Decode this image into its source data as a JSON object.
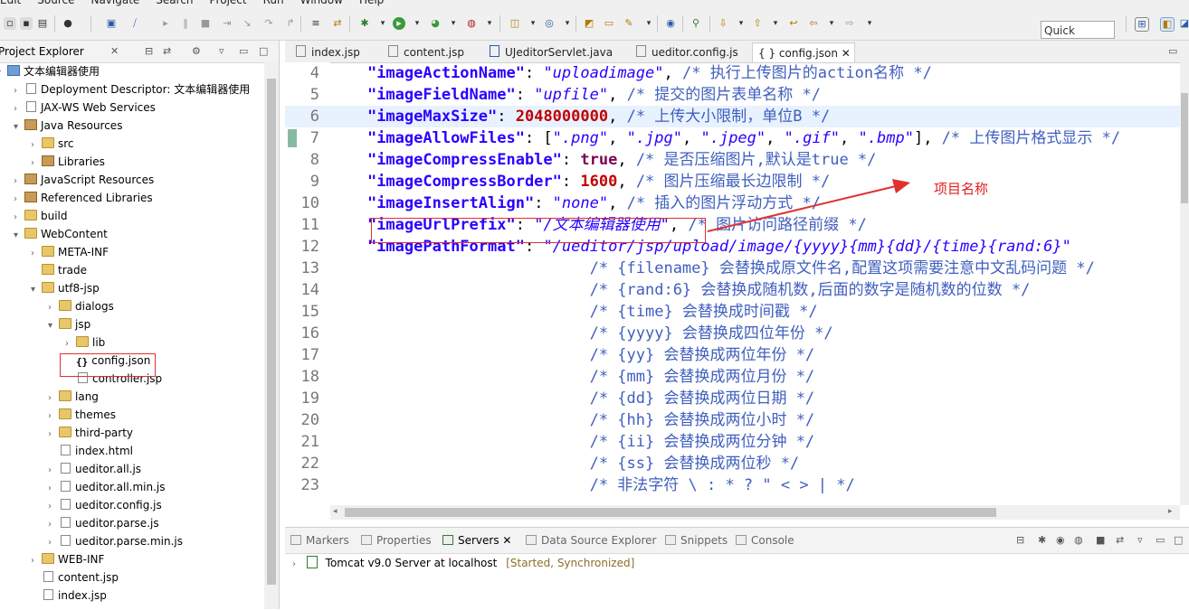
{
  "menu": [
    "Edit",
    "Source",
    "Navigate",
    "Search",
    "Project",
    "Run",
    "Window",
    "Help"
  ],
  "toolbar": {
    "quick_access": "Quick Access"
  },
  "explorer": {
    "title": "Project Explorer",
    "close": "✕",
    "tree": [
      {
        "label": "文本编辑器使用",
        "indent": 0,
        "arrow": "▾",
        "icon": "proj"
      },
      {
        "label": "Deployment Descriptor: 文本编辑器使用",
        "indent": 1,
        "arrow": "›",
        "icon": "file"
      },
      {
        "label": "JAX-WS Web Services",
        "indent": 1,
        "arrow": "›",
        "icon": "file"
      },
      {
        "label": "Java Resources",
        "indent": 1,
        "arrow": "▾",
        "icon": "lib"
      },
      {
        "label": "src",
        "indent": 2,
        "arrow": "›",
        "icon": "folder"
      },
      {
        "label": "Libraries",
        "indent": 2,
        "arrow": "›",
        "icon": "lib"
      },
      {
        "label": "JavaScript Resources",
        "indent": 1,
        "arrow": "›",
        "icon": "lib"
      },
      {
        "label": "Referenced Libraries",
        "indent": 1,
        "arrow": "›",
        "icon": "lib"
      },
      {
        "label": "build",
        "indent": 1,
        "arrow": "›",
        "icon": "folder"
      },
      {
        "label": "WebContent",
        "indent": 1,
        "arrow": "▾",
        "icon": "folder"
      },
      {
        "label": "META-INF",
        "indent": 2,
        "arrow": "›",
        "icon": "folder"
      },
      {
        "label": "trade",
        "indent": 2,
        "arrow": "",
        "icon": "folder"
      },
      {
        "label": "utf8-jsp",
        "indent": 2,
        "arrow": "▾",
        "icon": "folder"
      },
      {
        "label": "dialogs",
        "indent": 3,
        "arrow": "›",
        "icon": "folder"
      },
      {
        "label": "jsp",
        "indent": 3,
        "arrow": "▾",
        "icon": "folder"
      },
      {
        "label": "lib",
        "indent": 4,
        "arrow": "›",
        "icon": "folder"
      },
      {
        "label": "config.json",
        "indent": 4,
        "arrow": "",
        "icon": "json"
      },
      {
        "label": "controller.jsp",
        "indent": 4,
        "arrow": "",
        "icon": "file"
      },
      {
        "label": "lang",
        "indent": 3,
        "arrow": "›",
        "icon": "folder"
      },
      {
        "label": "themes",
        "indent": 3,
        "arrow": "›",
        "icon": "folder"
      },
      {
        "label": "third-party",
        "indent": 3,
        "arrow": "›",
        "icon": "folder"
      },
      {
        "label": "index.html",
        "indent": 3,
        "arrow": "",
        "icon": "file"
      },
      {
        "label": "ueditor.all.js",
        "indent": 3,
        "arrow": "›",
        "icon": "file"
      },
      {
        "label": "ueditor.all.min.js",
        "indent": 3,
        "arrow": "›",
        "icon": "file"
      },
      {
        "label": "ueditor.config.js",
        "indent": 3,
        "arrow": "›",
        "icon": "file"
      },
      {
        "label": "ueditor.parse.js",
        "indent": 3,
        "arrow": "›",
        "icon": "file"
      },
      {
        "label": "ueditor.parse.min.js",
        "indent": 3,
        "arrow": "›",
        "icon": "file"
      },
      {
        "label": "WEB-INF",
        "indent": 2,
        "arrow": "›",
        "icon": "folder"
      },
      {
        "label": "content.jsp",
        "indent": 2,
        "arrow": "",
        "icon": "file"
      },
      {
        "label": "index.jsp",
        "indent": 2,
        "arrow": "",
        "icon": "file"
      }
    ]
  },
  "editor": {
    "tabs": [
      {
        "label": "index.jsp"
      },
      {
        "label": "content.jsp"
      },
      {
        "label": "UJeditorServlet.java"
      },
      {
        "label": "ueditor.config.js"
      },
      {
        "label": "{ } config.json  ✕"
      }
    ],
    "lines": [
      {
        "n": "4",
        "parts": [
          [
            "p",
            "    "
          ],
          [
            "k",
            "\"imageActionName\""
          ],
          [
            "p",
            ": "
          ],
          [
            "s",
            "\"uploadimage\""
          ],
          [
            "p",
            ", "
          ],
          [
            "c",
            "/* 执行上传图片的action名称 */"
          ]
        ]
      },
      {
        "n": "5",
        "parts": [
          [
            "p",
            "    "
          ],
          [
            "k",
            "\"imageFieldName\""
          ],
          [
            "p",
            ": "
          ],
          [
            "s",
            "\"upfile\""
          ],
          [
            "p",
            ", "
          ],
          [
            "c",
            "/* 提交的图片表单名称 */"
          ]
        ]
      },
      {
        "n": "6",
        "parts": [
          [
            "p",
            "    "
          ],
          [
            "k",
            "\"imageMaxSize\""
          ],
          [
            "p",
            ": "
          ],
          [
            "n",
            "2048000000"
          ],
          [
            "p",
            ", "
          ],
          [
            "c",
            "/* 上传大小限制，单位B */"
          ]
        ]
      },
      {
        "n": "7",
        "parts": [
          [
            "p",
            "    "
          ],
          [
            "k",
            "\"imageAllowFiles\""
          ],
          [
            "p",
            ": ["
          ],
          [
            "s",
            "\".png\""
          ],
          [
            "p",
            ", "
          ],
          [
            "s",
            "\".jpg\""
          ],
          [
            "p",
            ", "
          ],
          [
            "s",
            "\".jpeg\""
          ],
          [
            "p",
            ", "
          ],
          [
            "s",
            "\".gif\""
          ],
          [
            "p",
            ", "
          ],
          [
            "s",
            "\".bmp\""
          ],
          [
            "p",
            "], "
          ],
          [
            "c",
            "/* 上传图片格式显示 */"
          ]
        ]
      },
      {
        "n": "8",
        "parts": [
          [
            "p",
            "    "
          ],
          [
            "k",
            "\"imageCompressEnable\""
          ],
          [
            "p",
            ": "
          ],
          [
            "b",
            "true"
          ],
          [
            "p",
            ", "
          ],
          [
            "c",
            "/* 是否压缩图片,默认是true */"
          ]
        ]
      },
      {
        "n": "9",
        "parts": [
          [
            "p",
            "    "
          ],
          [
            "k",
            "\"imageCompressBorder\""
          ],
          [
            "p",
            ": "
          ],
          [
            "n",
            "1600"
          ],
          [
            "p",
            ", "
          ],
          [
            "c",
            "/* 图片压缩最长边限制 */"
          ]
        ]
      },
      {
        "n": "10",
        "parts": [
          [
            "p",
            "    "
          ],
          [
            "k",
            "\"imageInsertAlign\""
          ],
          [
            "p",
            ": "
          ],
          [
            "s",
            "\"none\""
          ],
          [
            "p",
            ", "
          ],
          [
            "c",
            "/* 插入的图片浮动方式 */"
          ]
        ]
      },
      {
        "n": "11",
        "parts": [
          [
            "p",
            "    "
          ],
          [
            "k",
            "\"imageUrlPrefix\""
          ],
          [
            "p",
            ": "
          ],
          [
            "s",
            "\"/文本编辑器使用\""
          ],
          [
            "p",
            ", "
          ],
          [
            "c",
            "/* 图片访问路径前缀 */"
          ]
        ]
      },
      {
        "n": "12",
        "parts": [
          [
            "p",
            "    "
          ],
          [
            "k",
            "\"imagePathFormat\""
          ],
          [
            "p",
            ": "
          ],
          [
            "s",
            "\"/ueditor/jsp/upload/image/{yyyy}{mm}{dd}/{time}{rand:6}\""
          ]
        ]
      },
      {
        "n": "13",
        "parts": [
          [
            "p",
            "                            "
          ],
          [
            "c",
            "/* {filename} 会替换成原文件名,配置这项需要注意中文乱码问题 */"
          ]
        ]
      },
      {
        "n": "14",
        "parts": [
          [
            "p",
            "                            "
          ],
          [
            "c",
            "/* {rand:6} 会替换成随机数,后面的数字是随机数的位数 */"
          ]
        ]
      },
      {
        "n": "15",
        "parts": [
          [
            "p",
            "                            "
          ],
          [
            "c",
            "/* {time} 会替换成时间戳 */"
          ]
        ]
      },
      {
        "n": "16",
        "parts": [
          [
            "p",
            "                            "
          ],
          [
            "c",
            "/* {yyyy} 会替换成四位年份 */"
          ]
        ]
      },
      {
        "n": "17",
        "parts": [
          [
            "p",
            "                            "
          ],
          [
            "c",
            "/* {yy} 会替换成两位年份 */"
          ]
        ]
      },
      {
        "n": "18",
        "parts": [
          [
            "p",
            "                            "
          ],
          [
            "c",
            "/* {mm} 会替换成两位月份 */"
          ]
        ]
      },
      {
        "n": "19",
        "parts": [
          [
            "p",
            "                            "
          ],
          [
            "c",
            "/* {dd} 会替换成两位日期 */"
          ]
        ]
      },
      {
        "n": "20",
        "parts": [
          [
            "p",
            "                            "
          ],
          [
            "c",
            "/* {hh} 会替换成两位小时 */"
          ]
        ]
      },
      {
        "n": "21",
        "parts": [
          [
            "p",
            "                            "
          ],
          [
            "c",
            "/* {ii} 会替换成两位分钟 */"
          ]
        ]
      },
      {
        "n": "22",
        "parts": [
          [
            "p",
            "                            "
          ],
          [
            "c",
            "/* {ss} 会替换成两位秒 */"
          ]
        ]
      },
      {
        "n": "23",
        "parts": [
          [
            "p",
            "                            "
          ],
          [
            "c",
            "/* 非法字符 \\ : * ? \" < > | */"
          ]
        ]
      }
    ]
  },
  "bottom": {
    "tabs": [
      "Markers",
      "Properties",
      "Servers ✕",
      "Data Source Explorer",
      "Snippets",
      "Console"
    ],
    "server_name": "Tomcat v9.0 Server at localhost",
    "server_status": "[Started, Synchronized]"
  },
  "annotation": {
    "label": "项目名称",
    "color": "#e02020"
  }
}
